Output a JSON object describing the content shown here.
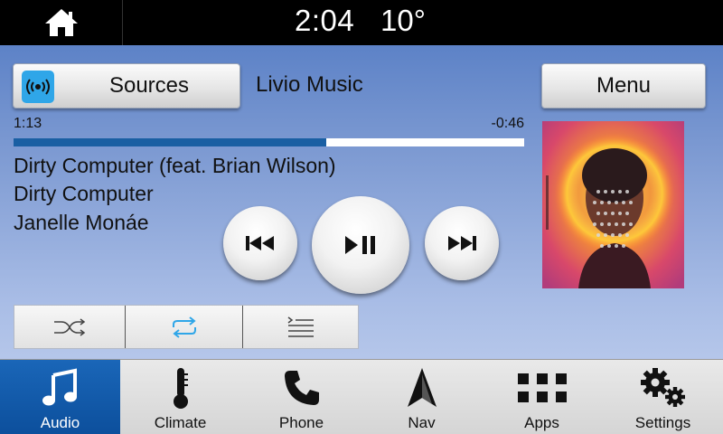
{
  "status": {
    "time": "2:04",
    "temperature": "10°"
  },
  "header": {
    "sources_label": "Sources",
    "source_name": "Livio Music",
    "menu_label": "Menu"
  },
  "playback": {
    "elapsed": "1:13",
    "remaining": "-0:46",
    "progress": 0.613
  },
  "track": {
    "title": "Dirty Computer (feat. Brian Wilson)",
    "album": "Dirty Computer",
    "artist": "Janelle Monáe"
  },
  "controls": {
    "icons": [
      "previous-track-icon",
      "play-pause-icon",
      "next-track-icon"
    ]
  },
  "modes": {
    "icons": [
      "shuffle-icon",
      "repeat-icon",
      "queue-list-icon"
    ],
    "repeat_color": "#2fa6e8"
  },
  "nav": {
    "active_color": "#0c4f9c",
    "items": [
      {
        "label": "Audio",
        "icon": "music-note-icon",
        "active": true
      },
      {
        "label": "Climate",
        "icon": "thermometer-icon",
        "active": false
      },
      {
        "label": "Phone",
        "icon": "phone-icon",
        "active": false
      },
      {
        "label": "Nav",
        "icon": "navigation-arrow-icon",
        "active": false
      },
      {
        "label": "Apps",
        "icon": "apps-grid-icon",
        "active": false
      },
      {
        "label": "Settings",
        "icon": "gears-icon",
        "active": false
      }
    ]
  }
}
